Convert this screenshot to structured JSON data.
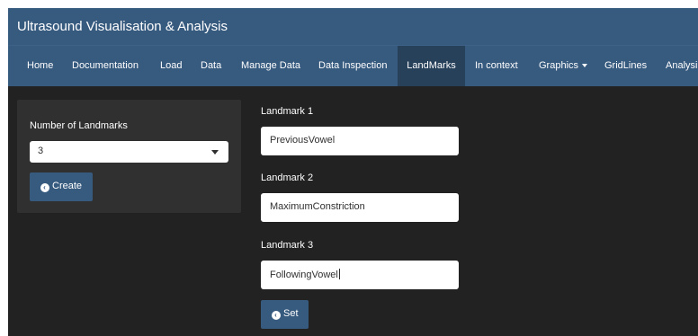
{
  "app": {
    "title": "Ultrasound Visualisation & Analysis"
  },
  "nav": {
    "items": [
      {
        "label": "Home"
      },
      {
        "label": "Documentation"
      },
      {
        "label": "Load"
      },
      {
        "label": "Data"
      },
      {
        "label": "Manage Data"
      },
      {
        "label": "Data Inspection"
      },
      {
        "label": "LandMarks",
        "active": true
      },
      {
        "label": "In context"
      },
      {
        "label": "Graphics",
        "dropdown": true
      },
      {
        "label": "GridLines"
      },
      {
        "label": "Analysi"
      }
    ]
  },
  "landmark_count": {
    "label": "Number of Landmarks",
    "selected": "3",
    "create_label": "Create"
  },
  "landmarks": [
    {
      "label": "Landmark 1",
      "value": "PreviousVowel"
    },
    {
      "label": "Landmark 2",
      "value": "MaximumConstriction"
    },
    {
      "label": "Landmark 3",
      "value": "FollowingVowel"
    }
  ],
  "set_label": "Set",
  "icons": {
    "create": "circle-chevron-left-icon",
    "set": "circle-chevron-left-icon",
    "select": "caret-down-icon"
  },
  "colors": {
    "primary": "#375a7f",
    "background": "#222222",
    "panel": "#303030"
  }
}
